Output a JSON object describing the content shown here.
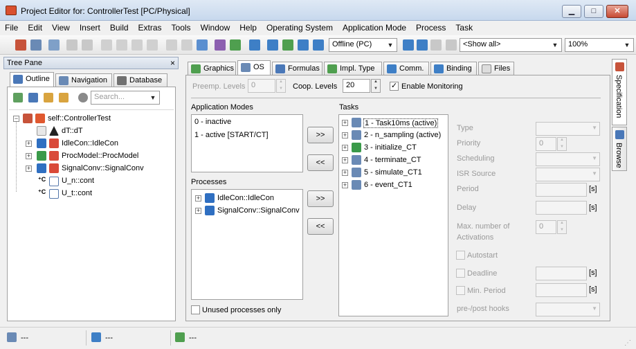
{
  "window": {
    "title": "Project Editor for: ControllerTest [PC/Physical]",
    "minimize": "▁",
    "maximize": "□",
    "close": "✕"
  },
  "menu": [
    "File",
    "Edit",
    "View",
    "Insert",
    "Build",
    "Extras",
    "Tools",
    "Window",
    "Help",
    "Operating System",
    "Application Mode",
    "Process",
    "Task"
  ],
  "toolbar": {
    "mode_select": "Offline (PC)",
    "filter_select": "<Show all>",
    "zoom_select": "100%"
  },
  "tree_pane": {
    "title": "Tree Pane",
    "close": "×",
    "tabs": [
      "Outline",
      "Navigation",
      "Database"
    ],
    "search_placeholder": "Search...",
    "items": [
      {
        "label": "self::ControllerTest",
        "icon": "project-icon"
      },
      {
        "label": "dT::dT",
        "icon": "timer-icon"
      },
      {
        "label": "IdleCon::IdleCon",
        "icon": "module-icon"
      },
      {
        "label": "ProcModel::ProcModel",
        "icon": "module-icon"
      },
      {
        "label": "SignalConv::SignalConv",
        "icon": "module-icon"
      },
      {
        "label": "U_n::cont",
        "icon": "message-icon"
      },
      {
        "label": "U_t::cont",
        "icon": "message-icon"
      }
    ]
  },
  "editor_tabs": [
    "Graphics",
    "OS",
    "Formulas",
    "Impl. Type",
    "Comm.",
    "Binding",
    "Files"
  ],
  "side_tabs": [
    "Specification",
    "Browse"
  ],
  "os": {
    "preemp_label": "Preemp. Levels",
    "preemp_value": "0",
    "coop_label": "Coop. Levels",
    "coop_value": "20",
    "monitoring_label": "Enable Monitoring",
    "monitoring_check": "✓",
    "app_modes_label": "Application Modes",
    "app_modes": [
      "0 - inactive",
      "1 - active [START/CT]"
    ],
    "processes_label": "Processes",
    "processes": [
      "IdleCon::IdleCon",
      "SignalConv::SignalConv"
    ],
    "unused_label": "Unused processes only",
    "tasks_label": "Tasks",
    "tasks": [
      "1 - Task10ms (active)",
      "2 - n_sampling (active)",
      "3 - initialize_CT",
      "4 - terminate_CT",
      "5 - simulate_CT1",
      "6 - event_CT1"
    ],
    "add_btn": ">>",
    "remove_btn": "<<",
    "props": {
      "type": "Type",
      "priority": "Priority",
      "priority_value": "0",
      "scheduling": "Scheduling",
      "isr_source": "ISR Source",
      "period": "Period",
      "delay": "Delay",
      "max_act_1": "Max. number of",
      "max_act_2": "Activations",
      "max_act_value": "0",
      "autostart": "Autostart",
      "deadline": "Deadline",
      "min_period": "Min. Period",
      "hooks": "pre-/post hooks",
      "unit": "[s]"
    }
  },
  "status": [
    "---",
    "---",
    "---"
  ]
}
